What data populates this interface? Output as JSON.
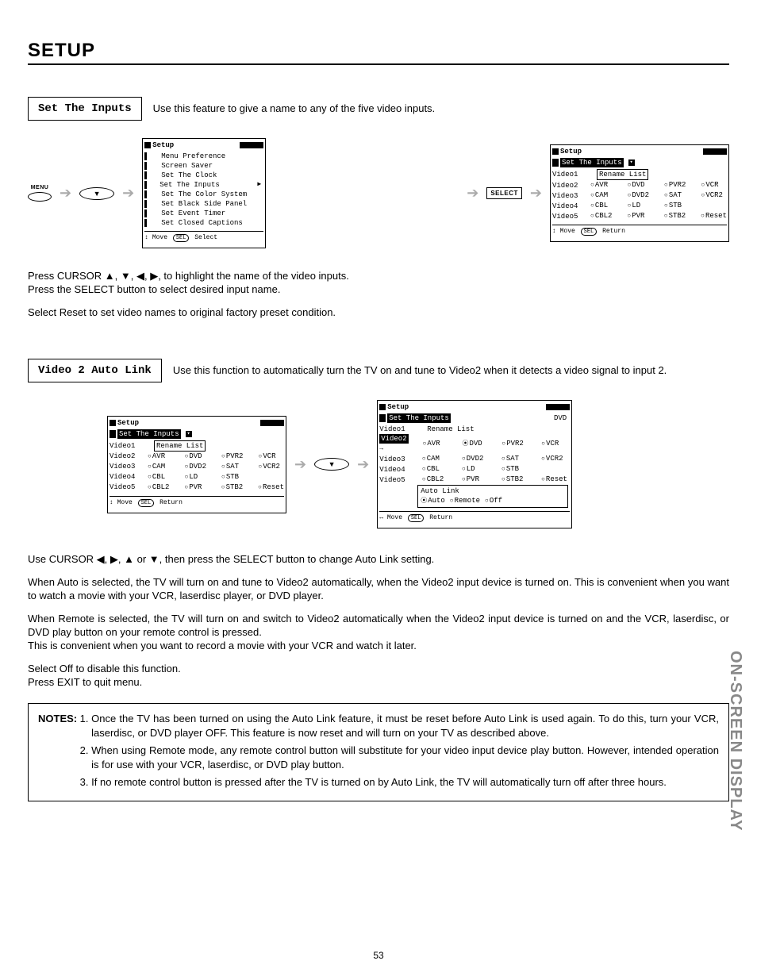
{
  "page": {
    "title": "SETUP",
    "sideLabel": "ON-SCREEN DISPLAY",
    "number": "53"
  },
  "sec1": {
    "label": "Set The Inputs",
    "intro": "Use this feature to give a name to any of the five video inputs.",
    "menuBtn": "MENU",
    "selectBtn": "SELECT",
    "dnGlyph": "▼",
    "osdA": {
      "title": "Setup",
      "items": [
        "Menu Preference",
        "Screen Saver",
        "Set The Clock"
      ],
      "highlight": "Set The Inputs",
      "items2": [
        "Set The Color System",
        "Set Black Side Panel",
        "Set Event Timer",
        "Set Closed Captions"
      ],
      "foot": {
        "move": "Move",
        "sel": "SEL",
        "select": "Select",
        "arrows": "↕"
      }
    },
    "osdB": {
      "title": "Setup",
      "sub": "Set The Inputs",
      "renameHeader": "Rename List",
      "videoCol": [
        "Video1",
        "Video2",
        "Video3",
        "Video4",
        "Video5"
      ],
      "rows": [
        [
          "AVR",
          "DVD",
          "PVR2",
          "VCR"
        ],
        [
          "CAM",
          "DVD2",
          "SAT",
          "VCR2"
        ],
        [
          "CBL",
          "LD",
          "STB",
          ""
        ],
        [
          "CBL2",
          "PVR",
          "STB2",
          "Reset"
        ]
      ],
      "foot": {
        "move": "Move",
        "sel": "SEL",
        "ret": "Return",
        "arrows": "↕"
      }
    },
    "body": [
      "Press CURSOR ▲, ▼, ◀, ▶, to highlight the name of the video inputs.",
      "Press the SELECT button to select desired input name.",
      "Select Reset to set video names to original factory preset condition."
    ]
  },
  "sec2": {
    "label": "Video 2 Auto Link",
    "intro": "Use this function to automatically turn the TV on and tune to Video2 when it detects a video signal to input 2.",
    "dnGlyph": "▼",
    "osdC": {
      "title": "Setup",
      "sub": "Set The Inputs",
      "renameHeader": "Rename List",
      "videoCol": [
        "Video1",
        "Video2",
        "Video3",
        "Video4",
        "Video5"
      ],
      "rows": [
        [
          "AVR",
          "DVD",
          "PVR2",
          "VCR"
        ],
        [
          "CAM",
          "DVD2",
          "SAT",
          "VCR2"
        ],
        [
          "CBL",
          "LD",
          "STB",
          ""
        ],
        [
          "CBL2",
          "PVR",
          "STB2",
          "Reset"
        ]
      ],
      "foot": {
        "move": "Move",
        "sel": "SEL",
        "ret": "Return",
        "arrows": "↕"
      }
    },
    "osdD": {
      "title": "Setup",
      "sub": "Set The Inputs",
      "rlabel": "DVD",
      "renameHeader": "Rename List",
      "videoCol": [
        "Video1",
        "Video2",
        "Video3",
        "Video4",
        "Video5"
      ],
      "highlightIdx": 1,
      "rows": [
        [
          {
            "t": "AVR"
          },
          {
            "t": "DVD",
            "sel": true
          },
          {
            "t": "PVR2"
          },
          {
            "t": "VCR"
          }
        ],
        [
          {
            "t": "CAM"
          },
          {
            "t": "DVD2"
          },
          {
            "t": "SAT"
          },
          {
            "t": "VCR2"
          }
        ],
        [
          {
            "t": "CBL"
          },
          {
            "t": "LD"
          },
          {
            "t": "STB"
          },
          {
            "t": ""
          }
        ],
        [
          {
            "t": "CBL2"
          },
          {
            "t": "PVR"
          },
          {
            "t": "STB2"
          },
          {
            "t": "Reset"
          }
        ]
      ],
      "autoLink": {
        "title": "Auto Link",
        "opts": [
          {
            "t": "Auto",
            "sel": true
          },
          {
            "t": "Remote"
          },
          {
            "t": "Off"
          }
        ]
      },
      "foot": {
        "move": "Move",
        "sel": "SEL",
        "ret": "Return",
        "arrows": "↔"
      }
    },
    "body": [
      "Use CURSOR ◀, ▶, ▲ or ▼, then press the SELECT button to change Auto Link setting.",
      "When Auto is selected, the TV will turn on and tune to Video2 automatically, when the Video2 input device is turned on. This is convenient when you want to watch a movie with your VCR, laserdisc player, or DVD player.",
      "When Remote is selected, the TV will turn on and switch to Video2 automatically when the Video2 input device is turned on and the VCR, laserdisc, or DVD play button on your remote control is pressed.",
      "This is convenient when you want to record a movie with your VCR and watch it later.",
      "Select Off to disable this function.",
      "Press EXIT to quit menu."
    ],
    "notes": {
      "label": "NOTES:",
      "items": [
        "Once the TV has been turned on using the Auto Link feature, it must be reset before Auto Link is used again. To do this, turn your VCR, laserdisc, or DVD player OFF. This feature is now reset and will turn on your TV as described above.",
        "When using Remote mode, any remote control button will substitute for your video input device play button. However, intended operation is for use with your VCR, laserdisc, or DVD play button.",
        "If no remote control button is pressed after the TV is turned on by Auto Link, the TV will automatically turn off after three hours."
      ]
    }
  }
}
